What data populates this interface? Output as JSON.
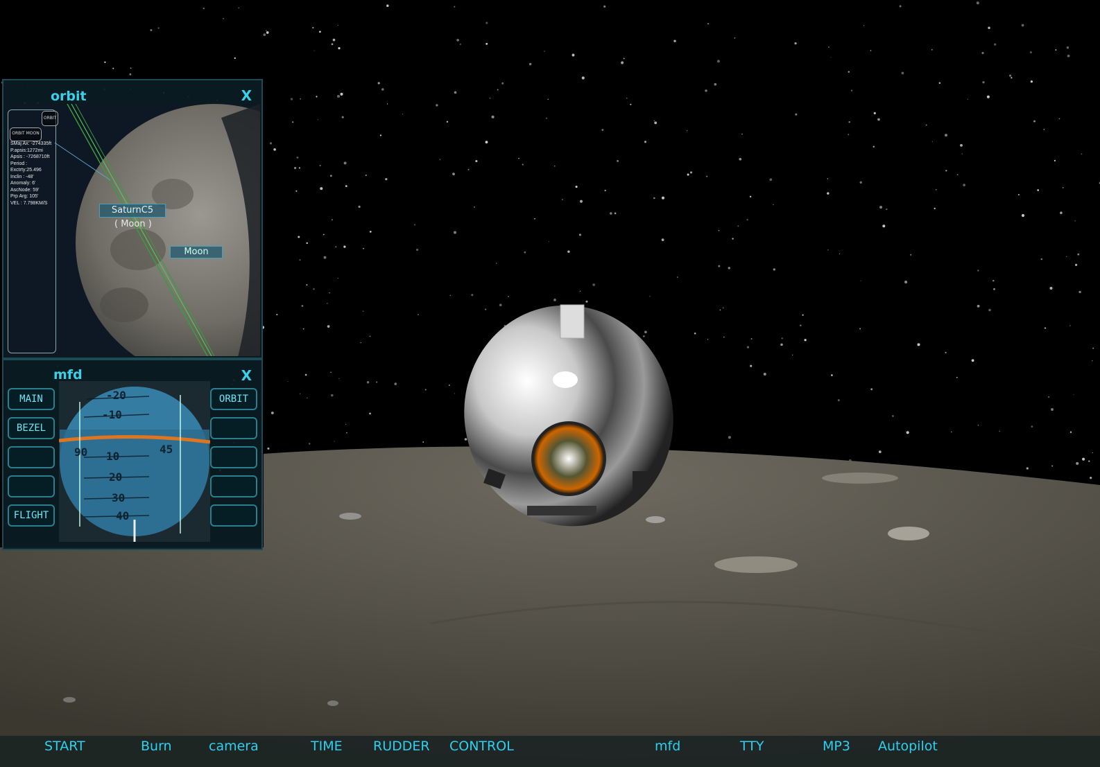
{
  "orbit_panel": {
    "title": "orbit",
    "close": "X",
    "mini_button": "ORBIT",
    "moon_button": "ORBIT MOON",
    "stats": [
      "SMaj Ax: -274335ft",
      "P.apsis:1272mi",
      "Apsis : -7268710ft",
      "Period :",
      "Exctrty:25.496",
      "Inclin : -48'",
      "Anomaly: 6'",
      "AscNode: 59'",
      "Prp Arg: 105'",
      "VEL    : 7.798KM/S"
    ],
    "vessel_tag": "SaturnC5",
    "vessel_sub": "( Moon )",
    "body_tag": "Moon"
  },
  "mfd_panel": {
    "title": "mfd",
    "close": "X",
    "left_buttons": [
      "MAIN",
      "BEZEL",
      "",
      "",
      "FLIGHT"
    ],
    "right_buttons": [
      "ORBIT",
      "",
      "",
      "",
      ""
    ],
    "pitch_labels": [
      "-20",
      "-10",
      "10",
      "20",
      "30",
      "40"
    ],
    "heading_labels": [
      "90",
      "45"
    ]
  },
  "bottom_menu": [
    "START",
    "Burn",
    "camera",
    "TIME",
    "RUDDER",
    "CONTROL",
    "mfd",
    "TTY",
    "MP3",
    "Autopilot"
  ],
  "colors": {
    "accent": "#3ad0ea",
    "panel_bg": "#0a1c24",
    "panel_border": "#1d4a55"
  }
}
